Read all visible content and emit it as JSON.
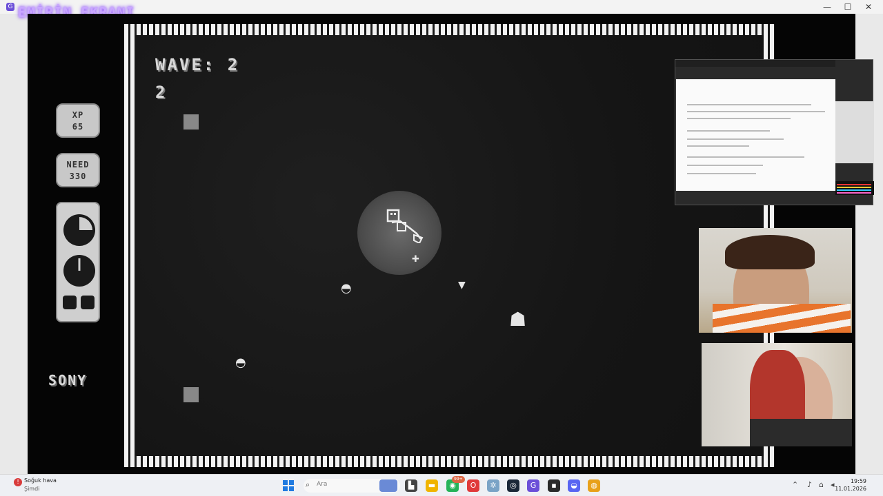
{
  "window": {
    "app_title": "EMİRİN EKRANI",
    "controls": {
      "minimize": "—",
      "maximize": "☐",
      "close": "✕"
    }
  },
  "hud": {
    "wave_label": "WAVE: 2",
    "count": "2",
    "xp_label": "XP",
    "xp_value": "65",
    "need_label": "NEED",
    "need_value": "330",
    "brand": "SONY"
  },
  "taskbar": {
    "weather_title": "Soğuk hava",
    "weather_sub": "Şimdi",
    "search_placeholder": "Ara",
    "notification_badge": "99+",
    "time": "19:59",
    "date": "11.01.2026"
  },
  "colors": {
    "title_glow": "#c9a7ff",
    "playfield_bg": "#141414",
    "panel_bg": "#050505",
    "taskbar_bg": "#eef0f4",
    "start_blue": "#1f7ae0"
  },
  "icons": {
    "start": "windows-start-icon",
    "search": "search-icon",
    "weather": "weather-alert-icon"
  }
}
